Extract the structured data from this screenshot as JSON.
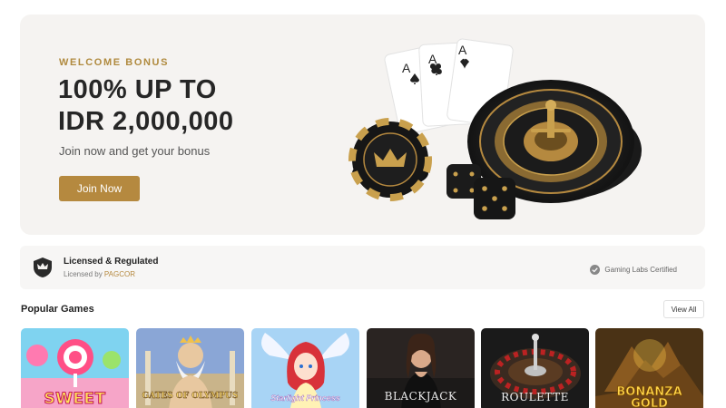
{
  "hero": {
    "eyebrow": "WELCOME BONUS",
    "title_line1": "100% UP TO",
    "title_line2": "IDR 2,000,000",
    "subtitle": "Join now and get your bonus",
    "cta_label": "Join Now",
    "card_ranks": [
      "A",
      "A",
      "A"
    ]
  },
  "license": {
    "title": "Licensed & Regulated",
    "sub_prefix": "Licensed by ",
    "sub_authority": "PAGCOR",
    "certification": "Gaming Labs Certified"
  },
  "popular": {
    "title": "Popular Games",
    "view_all_label": "View All",
    "games": [
      {
        "title": "SWEET BONANZA"
      },
      {
        "title": "GATES OF OLYMPUS"
      },
      {
        "title": "Starlight Princess"
      },
      {
        "title": "BLACKJACK"
      },
      {
        "title": "ROULETTE"
      },
      {
        "title_line1": "BONANZA",
        "title_line2": "GOLD"
      }
    ]
  },
  "colors": {
    "accent_gold": "#b5893f",
    "hero_bg": "#f5f3f1",
    "text_dark": "#262626"
  },
  "icons": [
    "shield-crown-icon",
    "check-circle-icon",
    "poker-chip-icon",
    "roulette-wheel-icon",
    "dice-icon",
    "playing-cards-icon"
  ]
}
